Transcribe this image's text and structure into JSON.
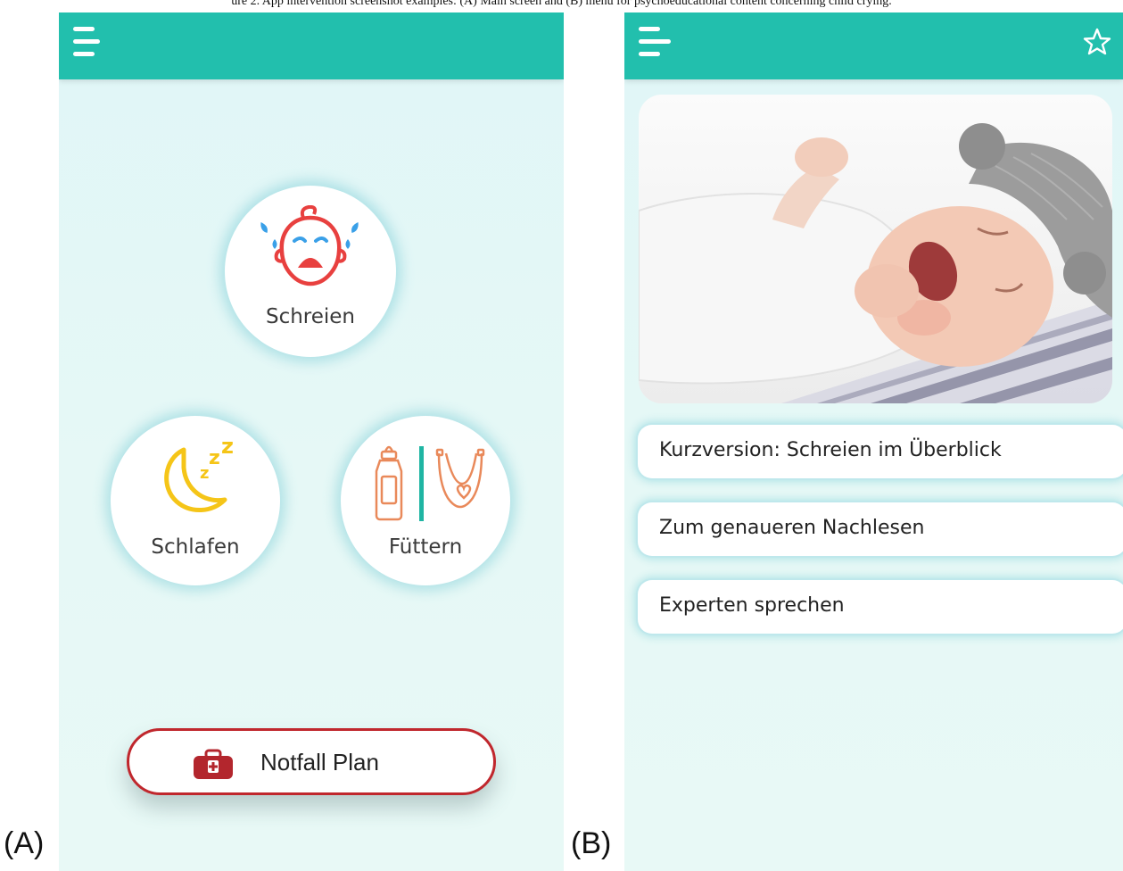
{
  "figure": {
    "caption": "ure 2. App intervention screenshot examples: (A) Main screen and (B) menu for psychoeducational content concerning child crying.",
    "label_a": "(A)",
    "label_b": "(B)"
  },
  "colors": {
    "appbar": "#22bfad",
    "background": "#e2f7f6",
    "emergency_red": "#c0272d",
    "sleep_yellow": "#f5c518",
    "cry_red": "#e8403f",
    "tear_blue": "#3aa0e8",
    "feed_orange": "#e9895a",
    "feed_divider": "#1fb5a3"
  },
  "screen_a": {
    "menu_icon": "hamburger-icon",
    "categories": [
      {
        "label": "Schreien",
        "icon": "crying-baby-icon"
      },
      {
        "label": "Schlafen",
        "icon": "moon-zzz-icon"
      },
      {
        "label": "Füttern",
        "icon": "bottle-bib-icon"
      }
    ],
    "emergency_button": {
      "label": "Notfall Plan",
      "icon": "first-aid-kit-icon"
    }
  },
  "screen_b": {
    "menu_icon": "hamburger-icon",
    "favorite_icon": "star-outline-icon",
    "hero_image": "crying-newborn-photo",
    "menu_items": [
      "Kurzversion: Schreien im Überblick",
      "Zum genaueren Nachlesen",
      "Experten sprechen"
    ]
  }
}
